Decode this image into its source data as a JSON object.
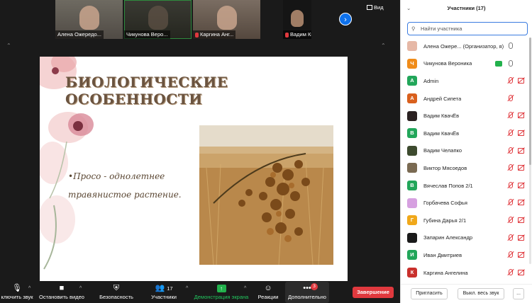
{
  "video_strip": [
    {
      "name": "Алена Ожередо..."
    },
    {
      "name": "Чикунова Веро..."
    },
    {
      "name": "Каргина Анг..."
    },
    {
      "name": "Вадим КвачЁв"
    }
  ],
  "view_label": "Вид",
  "slide": {
    "title_line1": "БИОЛОГИЧЕСКИЕ",
    "title_line2": "ОСОБЕННОСТИ",
    "bullet_line1": "•Просо - однолетнее",
    "bullet_line2": "травянистое растение."
  },
  "toolbar": {
    "mute_label": "ключить звук",
    "video_label": "Остановить видео",
    "security_label": "Безопасность",
    "participants_label": "Участники",
    "participants_count": "17",
    "share_label": "Демонстрация экрана",
    "reactions_label": "Реакции",
    "more_label": "Дополнительно",
    "more_badge": "3",
    "end_label": "Завершение"
  },
  "panel": {
    "title": "Участники (17)",
    "search_placeholder": "Найти участника",
    "invite_label": "Пригласить",
    "mute_all_label": "Выкл. весь звук",
    "more_label": "..."
  },
  "participants": [
    {
      "initial": "",
      "name": "Алена Ожере... (Организатор, я)",
      "color": "#e6b8a6",
      "mic": "on",
      "cam": "on",
      "share": false
    },
    {
      "initial": "Ч",
      "name": "Чикунова Вероника",
      "color": "#f08c1a",
      "mic": "on",
      "cam": "on",
      "share": true
    },
    {
      "initial": "A",
      "name": "Admin",
      "color": "#22a65a",
      "mic": "off",
      "cam": "off",
      "share": false
    },
    {
      "initial": "A",
      "name": "Андрей Сипета",
      "color": "#d9601d",
      "mic": "off",
      "cam": "none",
      "share": false
    },
    {
      "initial": "",
      "name": "Вадим КвачЁв",
      "color": "#2b2222",
      "mic": "off",
      "cam": "off",
      "share": false
    },
    {
      "initial": "В",
      "name": "Вадим КвачЁв",
      "color": "#22a65a",
      "mic": "off",
      "cam": "off",
      "share": false
    },
    {
      "initial": "",
      "name": "Вадим Челапко",
      "color": "#3d4a2e",
      "mic": "off",
      "cam": "off",
      "share": false
    },
    {
      "initial": "",
      "name": "Виктор Мясоедов",
      "color": "#7a6a52",
      "mic": "off",
      "cam": "off",
      "share": false
    },
    {
      "initial": "В",
      "name": "Вячеслав Попов 2/1",
      "color": "#22a65a",
      "mic": "off",
      "cam": "off",
      "share": false
    },
    {
      "initial": "",
      "name": "Горбачева Софья",
      "color": "#d6a0e0",
      "mic": "off",
      "cam": "off",
      "share": false
    },
    {
      "initial": "Г",
      "name": "Губина Дарья 2/1",
      "color": "#f0a81a",
      "mic": "off",
      "cam": "off",
      "share": false
    },
    {
      "initial": "",
      "name": "Запарин Александр",
      "color": "#1a1a1a",
      "mic": "off",
      "cam": "off",
      "share": false
    },
    {
      "initial": "И",
      "name": "Иван Дмитриев",
      "color": "#22a65a",
      "mic": "off",
      "cam": "off",
      "share": false
    },
    {
      "initial": "К",
      "name": "Каргина Ангелина",
      "color": "#c9302c",
      "mic": "off",
      "cam": "off",
      "share": false
    }
  ]
}
